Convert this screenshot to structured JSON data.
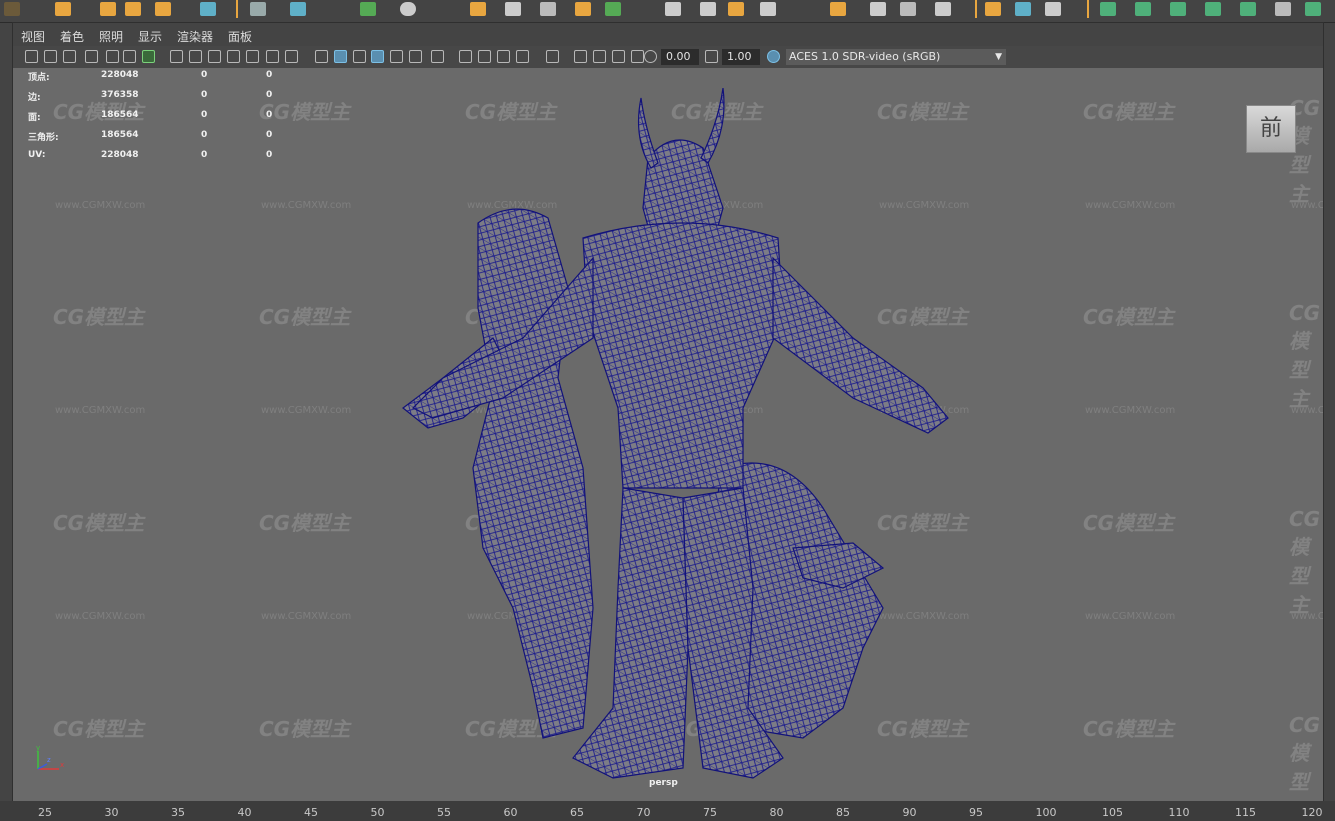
{
  "top_shelf": {
    "icons": [
      "select-icon",
      "move-icon",
      "rotate-icon",
      "scale-icon",
      "render-icon",
      "snap-icon",
      "camera-icon",
      "light-icon",
      "cube-icon",
      "sphere-icon",
      "history-icon",
      "toggle-icon"
    ]
  },
  "menu": {
    "items": [
      "视图",
      "着色",
      "照明",
      "显示",
      "渲染器",
      "面板"
    ]
  },
  "toolbar": {
    "exposure_value": "0.00",
    "gamma_value": "1.00",
    "colorspace": "ACES 1.0 SDR-video (sRGB)"
  },
  "hud": {
    "rows": [
      {
        "label": "顶点:",
        "values": [
          "228048",
          "0",
          "0"
        ]
      },
      {
        "label": "边:",
        "values": [
          "376358",
          "0",
          "0"
        ]
      },
      {
        "label": "面:",
        "values": [
          "186564",
          "0",
          "0"
        ]
      },
      {
        "label": "三角形:",
        "values": [
          "186564",
          "0",
          "0"
        ]
      },
      {
        "label": "UV:",
        "values": [
          "228048",
          "0",
          "0"
        ]
      }
    ]
  },
  "view_cube": {
    "label": "前"
  },
  "camera": {
    "name": "persp"
  },
  "watermark": {
    "text": "CG模型主",
    "url": "www.CGMXW.com"
  },
  "axis": {
    "x": "x",
    "y": "y",
    "z": "z"
  },
  "timeline": {
    "ticks": [
      "25",
      "30",
      "35",
      "40",
      "45",
      "50",
      "55",
      "60",
      "65",
      "70",
      "75",
      "80",
      "85",
      "90",
      "95",
      "100",
      "105",
      "110",
      "115",
      "120"
    ]
  },
  "colors": {
    "wire": "#1a1a8c",
    "viewport_bg": "#6a6a6a",
    "accent": "#e8a640"
  }
}
